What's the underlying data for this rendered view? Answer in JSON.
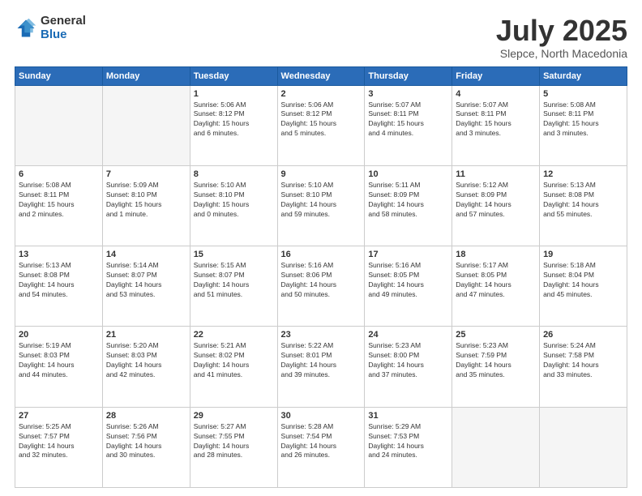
{
  "logo": {
    "general": "General",
    "blue": "Blue"
  },
  "header": {
    "month": "July 2025",
    "location": "Slepce, North Macedonia"
  },
  "weekdays": [
    "Sunday",
    "Monday",
    "Tuesday",
    "Wednesday",
    "Thursday",
    "Friday",
    "Saturday"
  ],
  "weeks": [
    [
      {
        "day": "",
        "info": ""
      },
      {
        "day": "",
        "info": ""
      },
      {
        "day": "1",
        "info": "Sunrise: 5:06 AM\nSunset: 8:12 PM\nDaylight: 15 hours\nand 6 minutes."
      },
      {
        "day": "2",
        "info": "Sunrise: 5:06 AM\nSunset: 8:12 PM\nDaylight: 15 hours\nand 5 minutes."
      },
      {
        "day": "3",
        "info": "Sunrise: 5:07 AM\nSunset: 8:11 PM\nDaylight: 15 hours\nand 4 minutes."
      },
      {
        "day": "4",
        "info": "Sunrise: 5:07 AM\nSunset: 8:11 PM\nDaylight: 15 hours\nand 3 minutes."
      },
      {
        "day": "5",
        "info": "Sunrise: 5:08 AM\nSunset: 8:11 PM\nDaylight: 15 hours\nand 3 minutes."
      }
    ],
    [
      {
        "day": "6",
        "info": "Sunrise: 5:08 AM\nSunset: 8:11 PM\nDaylight: 15 hours\nand 2 minutes."
      },
      {
        "day": "7",
        "info": "Sunrise: 5:09 AM\nSunset: 8:10 PM\nDaylight: 15 hours\nand 1 minute."
      },
      {
        "day": "8",
        "info": "Sunrise: 5:10 AM\nSunset: 8:10 PM\nDaylight: 15 hours\nand 0 minutes."
      },
      {
        "day": "9",
        "info": "Sunrise: 5:10 AM\nSunset: 8:10 PM\nDaylight: 14 hours\nand 59 minutes."
      },
      {
        "day": "10",
        "info": "Sunrise: 5:11 AM\nSunset: 8:09 PM\nDaylight: 14 hours\nand 58 minutes."
      },
      {
        "day": "11",
        "info": "Sunrise: 5:12 AM\nSunset: 8:09 PM\nDaylight: 14 hours\nand 57 minutes."
      },
      {
        "day": "12",
        "info": "Sunrise: 5:13 AM\nSunset: 8:08 PM\nDaylight: 14 hours\nand 55 minutes."
      }
    ],
    [
      {
        "day": "13",
        "info": "Sunrise: 5:13 AM\nSunset: 8:08 PM\nDaylight: 14 hours\nand 54 minutes."
      },
      {
        "day": "14",
        "info": "Sunrise: 5:14 AM\nSunset: 8:07 PM\nDaylight: 14 hours\nand 53 minutes."
      },
      {
        "day": "15",
        "info": "Sunrise: 5:15 AM\nSunset: 8:07 PM\nDaylight: 14 hours\nand 51 minutes."
      },
      {
        "day": "16",
        "info": "Sunrise: 5:16 AM\nSunset: 8:06 PM\nDaylight: 14 hours\nand 50 minutes."
      },
      {
        "day": "17",
        "info": "Sunrise: 5:16 AM\nSunset: 8:05 PM\nDaylight: 14 hours\nand 49 minutes."
      },
      {
        "day": "18",
        "info": "Sunrise: 5:17 AM\nSunset: 8:05 PM\nDaylight: 14 hours\nand 47 minutes."
      },
      {
        "day": "19",
        "info": "Sunrise: 5:18 AM\nSunset: 8:04 PM\nDaylight: 14 hours\nand 45 minutes."
      }
    ],
    [
      {
        "day": "20",
        "info": "Sunrise: 5:19 AM\nSunset: 8:03 PM\nDaylight: 14 hours\nand 44 minutes."
      },
      {
        "day": "21",
        "info": "Sunrise: 5:20 AM\nSunset: 8:03 PM\nDaylight: 14 hours\nand 42 minutes."
      },
      {
        "day": "22",
        "info": "Sunrise: 5:21 AM\nSunset: 8:02 PM\nDaylight: 14 hours\nand 41 minutes."
      },
      {
        "day": "23",
        "info": "Sunrise: 5:22 AM\nSunset: 8:01 PM\nDaylight: 14 hours\nand 39 minutes."
      },
      {
        "day": "24",
        "info": "Sunrise: 5:23 AM\nSunset: 8:00 PM\nDaylight: 14 hours\nand 37 minutes."
      },
      {
        "day": "25",
        "info": "Sunrise: 5:23 AM\nSunset: 7:59 PM\nDaylight: 14 hours\nand 35 minutes."
      },
      {
        "day": "26",
        "info": "Sunrise: 5:24 AM\nSunset: 7:58 PM\nDaylight: 14 hours\nand 33 minutes."
      }
    ],
    [
      {
        "day": "27",
        "info": "Sunrise: 5:25 AM\nSunset: 7:57 PM\nDaylight: 14 hours\nand 32 minutes."
      },
      {
        "day": "28",
        "info": "Sunrise: 5:26 AM\nSunset: 7:56 PM\nDaylight: 14 hours\nand 30 minutes."
      },
      {
        "day": "29",
        "info": "Sunrise: 5:27 AM\nSunset: 7:55 PM\nDaylight: 14 hours\nand 28 minutes."
      },
      {
        "day": "30",
        "info": "Sunrise: 5:28 AM\nSunset: 7:54 PM\nDaylight: 14 hours\nand 26 minutes."
      },
      {
        "day": "31",
        "info": "Sunrise: 5:29 AM\nSunset: 7:53 PM\nDaylight: 14 hours\nand 24 minutes."
      },
      {
        "day": "",
        "info": ""
      },
      {
        "day": "",
        "info": ""
      }
    ]
  ]
}
